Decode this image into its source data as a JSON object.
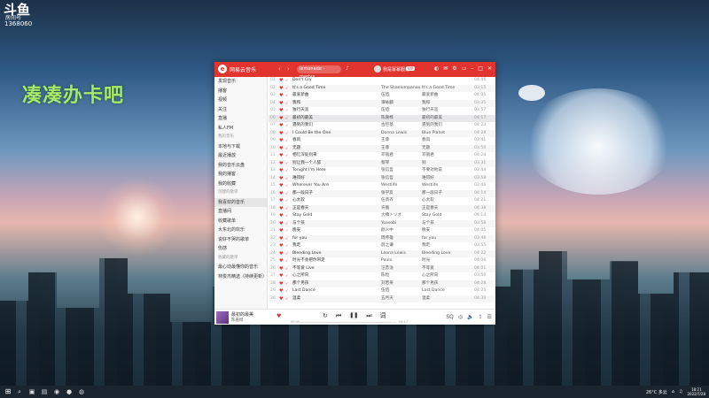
{
  "stream_logo": {
    "title": "斗鱼",
    "sub": "房间号",
    "room": "1368060"
  },
  "overlay_text": "凑凑办卡吧",
  "app": {
    "brand": "网易云音乐",
    "search_placeholder": "lemonade - mariya",
    "username": "我是幂幂服务",
    "vip": "VIP",
    "sidebar": [
      {
        "label": "发现音乐",
        "section": false
      },
      {
        "label": "播客",
        "section": false
      },
      {
        "label": "视频",
        "section": false
      },
      {
        "label": "关注",
        "section": false
      },
      {
        "label": "直播",
        "section": false
      },
      {
        "label": "私人FM",
        "section": false
      },
      {
        "label": "我的音乐",
        "section": true
      },
      {
        "label": "本地与下载",
        "section": false
      },
      {
        "label": "最近播放",
        "section": false
      },
      {
        "label": "我的音乐云盘",
        "section": false
      },
      {
        "label": "我的播客",
        "section": false
      },
      {
        "label": "我的收藏",
        "section": false
      },
      {
        "label": "创建的歌单",
        "section": true
      },
      {
        "label": "我喜欢的音乐",
        "section": false
      },
      {
        "label": "直播间",
        "section": false
      },
      {
        "label": "收藏歌单",
        "section": false
      },
      {
        "label": "大东北的欢乐",
        "section": false
      },
      {
        "label": "说好不哭的歌单",
        "section": false
      },
      {
        "label": "伤感",
        "section": false
      },
      {
        "label": "收藏的歌单",
        "section": true
      },
      {
        "label": "最心动最懂你的音乐",
        "section": false
      },
      {
        "label": "林俊杰精选（持续更新）",
        "section": false
      }
    ],
    "songs": [
      {
        "n": "01",
        "title": "Don't Cry",
        "artist": "",
        "album": "",
        "dur": "04:46"
      },
      {
        "n": "02",
        "title": "It's a Good Time",
        "artist": "The Shaelumpanaonx",
        "album": "It's a Good Time",
        "dur": "03:15"
      },
      {
        "n": "03",
        "title": "最爱新曲",
        "artist": "伍佰",
        "album": "最爱新曲",
        "dur": "04:05"
      },
      {
        "n": "04",
        "title": "我和",
        "artist": "谭咏麟",
        "album": "我和",
        "dur": "03:35"
      },
      {
        "n": "05",
        "title": "独行天涯",
        "artist": "伍佰",
        "album": "独行天涯",
        "dur": "03:57"
      },
      {
        "n": "06",
        "title": "最初的最美",
        "artist": "陈嘉桦",
        "album": "最初的最美",
        "dur": "04:17"
      },
      {
        "n": "07",
        "title": "遇到的我们",
        "artist": "古巨基",
        "album": "遇到的我们",
        "dur": "04:23"
      },
      {
        "n": "08",
        "title": "I Could Be the One",
        "artist": "Donna Lewis",
        "album": "Blue Planet",
        "dur": "04:28"
      },
      {
        "n": "09",
        "title": "春风",
        "artist": "王菲",
        "album": "春风",
        "dur": "03:41"
      },
      {
        "n": "10",
        "title": "无题",
        "artist": "王菲",
        "album": "无题",
        "dur": "03:50"
      },
      {
        "n": "11",
        "title": "相忆深处别来",
        "artist": "邓丽君",
        "album": "邓丽君",
        "dur": "04:24"
      },
      {
        "n": "12",
        "title": "别让我一个人醉",
        "artist": "蔡琴",
        "album": "别",
        "dur": "03:31"
      },
      {
        "n": "13",
        "title": "Tonight I'm Here",
        "artist": "张信哲",
        "album": "不要对他说",
        "dur": "03:44"
      },
      {
        "n": "14",
        "title": "难得好",
        "artist": "张信哲",
        "album": "难得好",
        "dur": "03:58"
      },
      {
        "n": "15",
        "title": "Wherever You Are",
        "artist": "Westlife",
        "album": "Westlife",
        "dur": "03:46"
      },
      {
        "n": "16",
        "title": "那一段日子",
        "artist": "张学友",
        "album": "那一段日子",
        "dur": "04:14"
      },
      {
        "n": "17",
        "title": "心太软",
        "artist": "任贤齐",
        "album": "心太软",
        "dur": "04:21"
      },
      {
        "n": "18",
        "title": "正是春天",
        "artist": "许嵩",
        "album": "正是春天",
        "dur": "04:38"
      },
      {
        "n": "19",
        "title": "Stay Gold",
        "artist": "大橋トリオ",
        "album": "Stay Gold",
        "dur": "04:14"
      },
      {
        "n": "20",
        "title": "与个孩",
        "artist": "Yoasobi",
        "album": "与个孩",
        "dur": "03:58"
      },
      {
        "n": "21",
        "title": "晚安",
        "artist": "颜人中",
        "album": "晚安",
        "dur": "04:05"
      },
      {
        "n": "22",
        "title": "for you",
        "artist": "周传雄",
        "album": "for you",
        "dur": "03:46"
      },
      {
        "n": "23",
        "title": "我走",
        "artist": "薛之谦",
        "album": "我走",
        "dur": "03:55"
      },
      {
        "n": "24",
        "title": "Bleeding Love",
        "artist": "Leona Lewis",
        "album": "Bleeding Love",
        "dur": "04:22"
      },
      {
        "n": "25",
        "title": "时光不会把你带走",
        "artist": "Paulo",
        "album": "时光",
        "dur": "04:06"
      },
      {
        "n": "26",
        "title": "不等爱 Live",
        "artist": "汪苏泷",
        "album": "不等爱",
        "dur": "04:01"
      },
      {
        "n": "27",
        "title": "心之所向",
        "artist": "陈粒",
        "album": "心之所向",
        "dur": "03:50"
      },
      {
        "n": "28",
        "title": "那个男孩",
        "artist": "刘若英",
        "album": "那个男孩",
        "dur": "04:28"
      },
      {
        "n": "29",
        "title": "Last Dance",
        "artist": "伍佰",
        "album": "Last Dance",
        "dur": "04:25"
      },
      {
        "n": "30",
        "title": "温柔",
        "artist": "五月天",
        "album": "温柔",
        "dur": "04:30"
      }
    ],
    "player": {
      "title": "最初的最美",
      "artist": "陈嘉桦",
      "t_cur": "00:45",
      "t_tot": "04:17"
    }
  },
  "taskbar": {
    "weather": "26°C 多云",
    "time": "18:21",
    "date": "2022/7/28"
  }
}
